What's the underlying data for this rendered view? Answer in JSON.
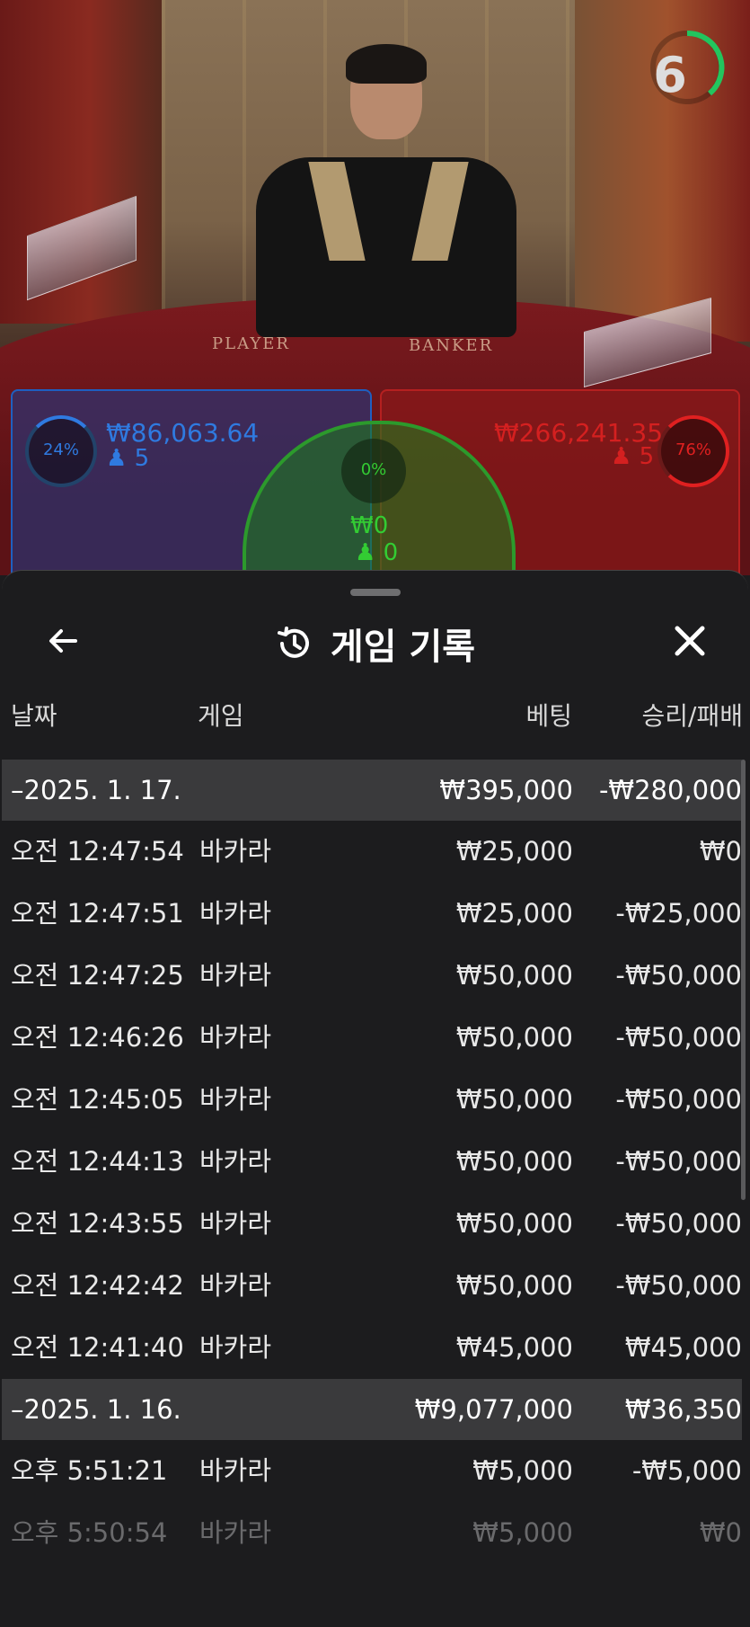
{
  "game_view": {
    "timer": "6",
    "felt_labels": {
      "player": "PLAYER",
      "banker": "BANKER"
    },
    "player_bet": {
      "percent": "24%",
      "amount": "₩86,063.64",
      "count": "5"
    },
    "banker_bet": {
      "percent": "76%",
      "amount": "₩266,241.35",
      "count": "5"
    },
    "tie_bet": {
      "percent": "0%",
      "amount": "₩0",
      "count": "0"
    },
    "colors": {
      "player": "#2f7ae0",
      "banker": "#d42020",
      "tie": "#33cc33"
    }
  },
  "sheet": {
    "title": "게임 기록",
    "icons": {
      "back": "arrow-left-icon",
      "history": "history-clock-icon",
      "close": "close-icon"
    },
    "columns": {
      "date": "날짜",
      "game": "게임",
      "bet": "베팅",
      "winloss": "승리/패배"
    },
    "groups": [
      {
        "date": "2025. 1. 17.",
        "bet_total": "₩395,000",
        "winloss_total": "-₩280,000",
        "rows": [
          {
            "time": "오전 12:47:54",
            "game": "바카라",
            "bet": "₩25,000",
            "winloss": "₩0"
          },
          {
            "time": "오전 12:47:51",
            "game": "바카라",
            "bet": "₩25,000",
            "winloss": "-₩25,000"
          },
          {
            "time": "오전 12:47:25",
            "game": "바카라",
            "bet": "₩50,000",
            "winloss": "-₩50,000"
          },
          {
            "time": "오전 12:46:26",
            "game": "바카라",
            "bet": "₩50,000",
            "winloss": "-₩50,000"
          },
          {
            "time": "오전 12:45:05",
            "game": "바카라",
            "bet": "₩50,000",
            "winloss": "-₩50,000"
          },
          {
            "time": "오전 12:44:13",
            "game": "바카라",
            "bet": "₩50,000",
            "winloss": "-₩50,000"
          },
          {
            "time": "오전 12:43:55",
            "game": "바카라",
            "bet": "₩50,000",
            "winloss": "-₩50,000"
          },
          {
            "time": "오전 12:42:42",
            "game": "바카라",
            "bet": "₩50,000",
            "winloss": "-₩50,000"
          },
          {
            "time": "오전 12:41:40",
            "game": "바카라",
            "bet": "₩45,000",
            "winloss": "₩45,000"
          }
        ]
      },
      {
        "date": "2025. 1. 16.",
        "bet_total": "₩9,077,000",
        "winloss_total": "₩36,350",
        "rows": [
          {
            "time": "오후 5:51:21",
            "game": "바카라",
            "bet": "₩5,000",
            "winloss": "-₩5,000"
          },
          {
            "time": "오후 5:50:54",
            "game": "바카라",
            "bet": "₩5,000",
            "winloss": "₩0"
          }
        ]
      }
    ]
  }
}
